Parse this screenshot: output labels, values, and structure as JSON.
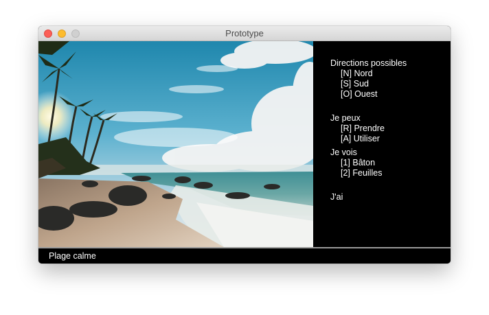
{
  "window": {
    "title": "Prototype"
  },
  "panel": {
    "directions": {
      "heading": "Directions possibles",
      "items": [
        "[N] Nord",
        "[S] Sud",
        "[O] Ouest"
      ]
    },
    "actions": {
      "heading": "Je peux",
      "items": [
        "[R] Prendre",
        "[A] Utiliser"
      ]
    },
    "visible": {
      "heading": "Je vois",
      "items": [
        "[1] Bâton",
        "[2] Feuilles"
      ]
    },
    "inventory": {
      "heading": "J'ai"
    }
  },
  "status": {
    "location": "Plage calme"
  },
  "colors": {
    "close": "#fc5f57",
    "minimize": "#fdbc2e",
    "zoom_disabled": "#d0d0d0",
    "panel_bg": "#000000",
    "text": "#ffffff"
  }
}
